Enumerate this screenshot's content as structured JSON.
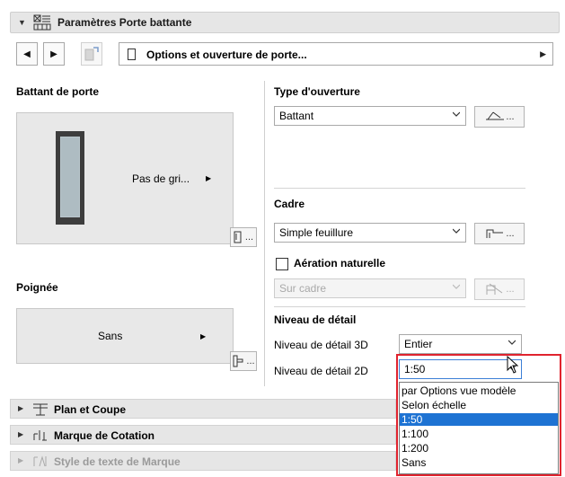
{
  "header": {
    "title": "Paramètres Porte battante"
  },
  "nav": {
    "selector_label": "Options et ouverture de porte..."
  },
  "battant": {
    "heading": "Battant de porte",
    "preview_label": "Pas de gri..."
  },
  "poignee": {
    "heading": "Poignée",
    "preview_label": "Sans"
  },
  "opening": {
    "heading": "Type d'ouverture",
    "select_value": "Battant",
    "button_label": "..."
  },
  "frame": {
    "heading": "Cadre",
    "select_value": "Simple feuillure",
    "button_label": "..."
  },
  "aeration": {
    "checkbox_label": "Aération naturelle",
    "select_value": "Sur cadre",
    "button_label": "..."
  },
  "detail": {
    "heading": "Niveau de détail",
    "label_3d": "Niveau de détail 3D",
    "value_3d": "Entier",
    "label_2d": "Niveau de détail 2D",
    "value_2d": "1:50",
    "options": [
      "par Options vue modèle",
      "Selon échelle",
      "1:50",
      "1:100",
      "1:200",
      "Sans"
    ],
    "selected_index": 2
  },
  "buttons": {
    "battant_more": "...",
    "poignee_more": "..."
  },
  "sections": {
    "plan": "Plan et Coupe",
    "marque": "Marque de Cotation",
    "style": "Style de texte de Marque"
  },
  "colors": {
    "highlight": "#1e73d3",
    "callout": "#e0232e"
  }
}
